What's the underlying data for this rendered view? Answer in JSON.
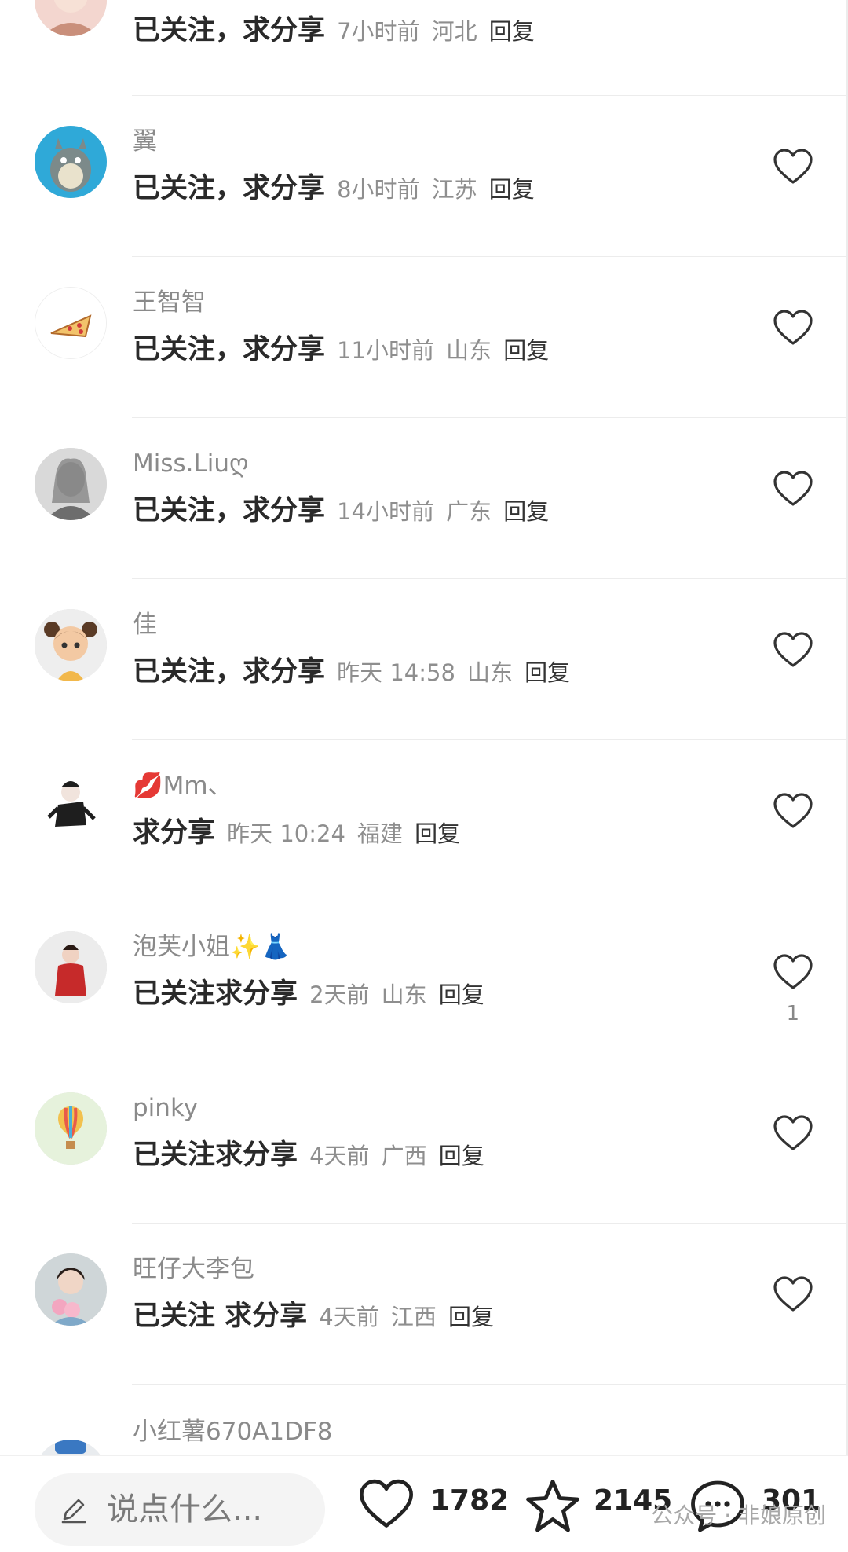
{
  "comments": [
    {
      "username": "",
      "text": "已关注，求分享",
      "time": "7小时前",
      "location": "河北",
      "reply": "回复",
      "likes": ""
    },
    {
      "username": "翼",
      "text": "已关注，求分享",
      "time": "8小时前",
      "location": "江苏",
      "reply": "回复",
      "likes": ""
    },
    {
      "username": "王智智",
      "text": "已关注，求分享",
      "time": "11小时前",
      "location": "山东",
      "reply": "回复",
      "likes": ""
    },
    {
      "username": "Miss.Liuღ",
      "text": "已关注，求分享",
      "time": "14小时前",
      "location": "广东",
      "reply": "回复",
      "likes": ""
    },
    {
      "username": "佳",
      "text": "已关注，求分享",
      "time": "昨天 14:58",
      "location": "山东",
      "reply": "回复",
      "likes": ""
    },
    {
      "username": "💋Mm、",
      "text": "求分享",
      "time": "昨天 10:24",
      "location": "福建",
      "reply": "回复",
      "likes": ""
    },
    {
      "username": "泡芙小姐✨👗",
      "text": "已关注求分享",
      "time": "2天前",
      "location": "山东",
      "reply": "回复",
      "likes": "1"
    },
    {
      "username": "pinky",
      "text": "已关注求分享",
      "time": "4天前",
      "location": "广西",
      "reply": "回复",
      "likes": ""
    },
    {
      "username": "旺仔大李包",
      "text": "已关注 求分享",
      "time": "4天前",
      "location": "江西",
      "reply": "回复",
      "likes": ""
    },
    {
      "username": "小红薯670A1DF8",
      "text": "",
      "time": "",
      "location": "",
      "reply": "",
      "likes": ""
    }
  ],
  "bottom_bar": {
    "input_placeholder": "说点什么...",
    "like_count": "1782",
    "collect_count": "2145",
    "comment_count": "301",
    "watermark": "公众号 · 非娘原创"
  },
  "colors": {
    "divider": "#ececec",
    "username": "#8a8a8a",
    "meta": "#8e8e8e",
    "text": "#2a2a2a"
  },
  "icons": {
    "like": "heart-outline-icon",
    "collect": "star-outline-icon",
    "comment": "chat-bubble-icon",
    "edit": "pencil-icon"
  }
}
